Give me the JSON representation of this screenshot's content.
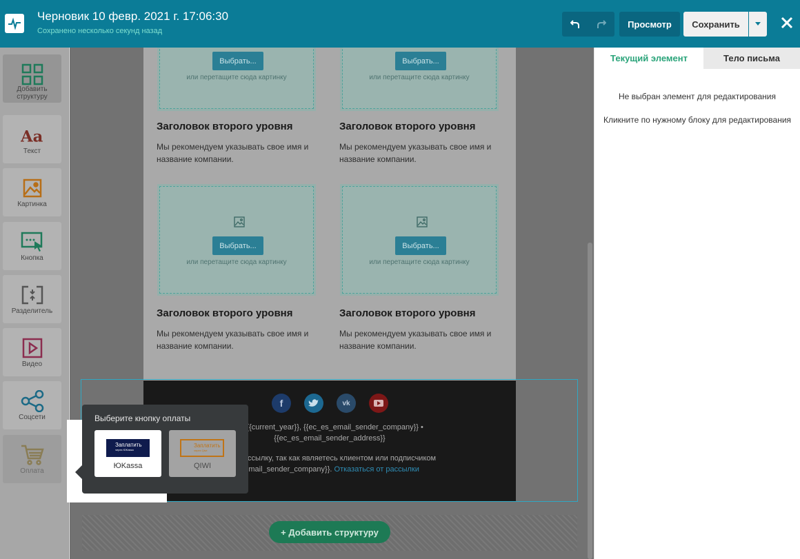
{
  "header": {
    "title": "Черновик 10 февр. 2021 г. 17:06:30",
    "subtitle": "Сохранено несколько секунд назад",
    "preview_label": "Просмотр",
    "save_label": "Сохранить"
  },
  "sidebar": {
    "items": [
      {
        "label": "Добавить структуру"
      },
      {
        "label": "Текст"
      },
      {
        "label": "Картинка"
      },
      {
        "label": "Кнопка"
      },
      {
        "label": "Разделитель"
      },
      {
        "label": "Видео"
      },
      {
        "label": "Соцсети"
      },
      {
        "label": "Оплата"
      }
    ]
  },
  "email": {
    "pick_label": "Выбрать...",
    "drop_hint": "или перетащите сюда картинку",
    "heading": "Заголовок второго уровня",
    "paragraph_line1": "Мы рекомендуем указывать свое имя и",
    "paragraph_line2": "название компании.",
    "footer": {
      "line1": "ht, {{current_year}}, {{ec_es_email_sender_company}} •",
      "line2": "{{ec_es_email_sender_address}}",
      "line3": "ную рассылку, так как являетесь клиентом или подписчиком",
      "line4_prefix": "_email_sender_company}}.",
      "unsubscribe": "Отказаться от рассылки"
    }
  },
  "add_structure_label": "+ Добавить структуру",
  "popover": {
    "title": "Выберите кнопку оплаты",
    "options": [
      {
        "label": "ЮKassa",
        "button_text": "Заплатить",
        "button_sub": "через ЮKassa"
      },
      {
        "label": "QIWI",
        "button_text": "Заплатить",
        "button_sub": "через Qiwi"
      }
    ]
  },
  "right_panel": {
    "tabs": [
      {
        "label": "Текущий элемент",
        "active": true
      },
      {
        "label": "Тело письма",
        "active": false
      }
    ],
    "no_selection": "Не выбран элемент для редактирования",
    "hint": "Кликните по нужному блоку для редактирования"
  },
  "colors": {
    "header_bg": "#0b7c97",
    "accent_green": "#1d7a55",
    "tab_active": "#2aa47a"
  }
}
